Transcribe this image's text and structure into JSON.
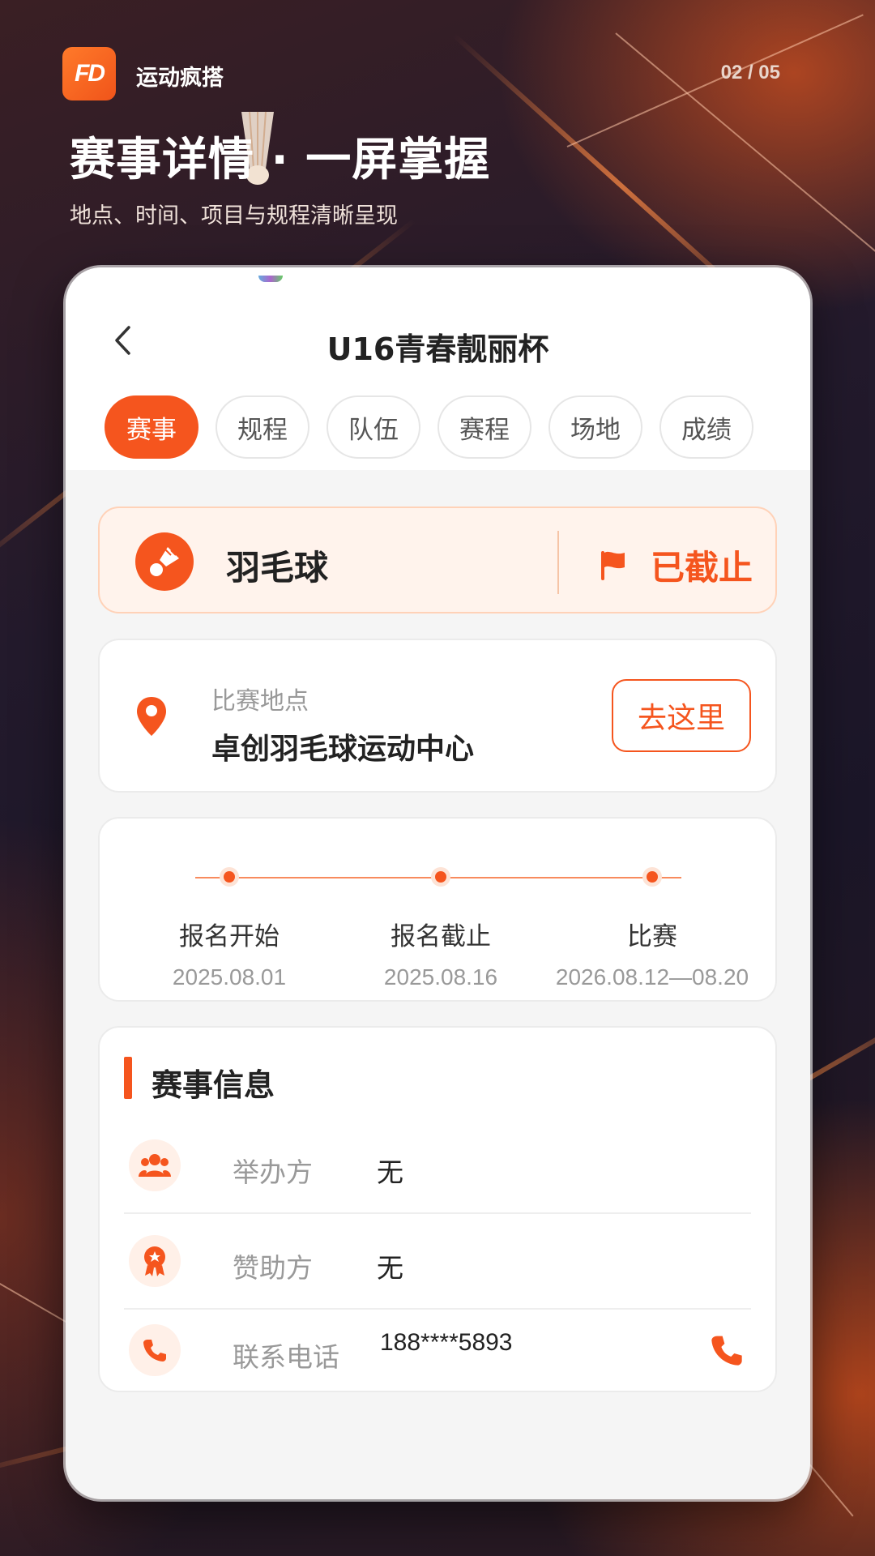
{
  "header": {
    "logo_text": "FD",
    "brand": "运动疯搭",
    "pager": "02 / 05",
    "headline": "赛事详情 · 一屏掌握",
    "subline": "地点、时间、项目与规程清晰呈现"
  },
  "app": {
    "title": "U16青春靓丽杯",
    "tabs": [
      {
        "label": "赛事",
        "active": true
      },
      {
        "label": "规程",
        "active": false
      },
      {
        "label": "队伍",
        "active": false
      },
      {
        "label": "赛程",
        "active": false
      },
      {
        "label": "场地",
        "active": false
      },
      {
        "label": "成绩",
        "active": false
      }
    ],
    "sport": {
      "name": "羽毛球",
      "status": "已截止"
    },
    "location": {
      "label": "比赛地点",
      "name": "卓创羽毛球运动中心",
      "button": "去这里"
    },
    "timeline": [
      {
        "label": "报名开始",
        "date": "2025.08.01"
      },
      {
        "label": "报名截止",
        "date": "2025.08.16"
      },
      {
        "label": "比赛",
        "date": "2026.08.12—08.20"
      }
    ],
    "info": {
      "title": "赛事信息",
      "rows": [
        {
          "label": "举办方",
          "value": "无",
          "icon": "group-icon"
        },
        {
          "label": "赞助方",
          "value": "无",
          "icon": "award-icon"
        },
        {
          "label": "联系电话",
          "value": "188****5893",
          "icon": "phone-icon"
        }
      ]
    }
  },
  "colors": {
    "accent": "#f5551e",
    "background": "#f5f5f5"
  }
}
